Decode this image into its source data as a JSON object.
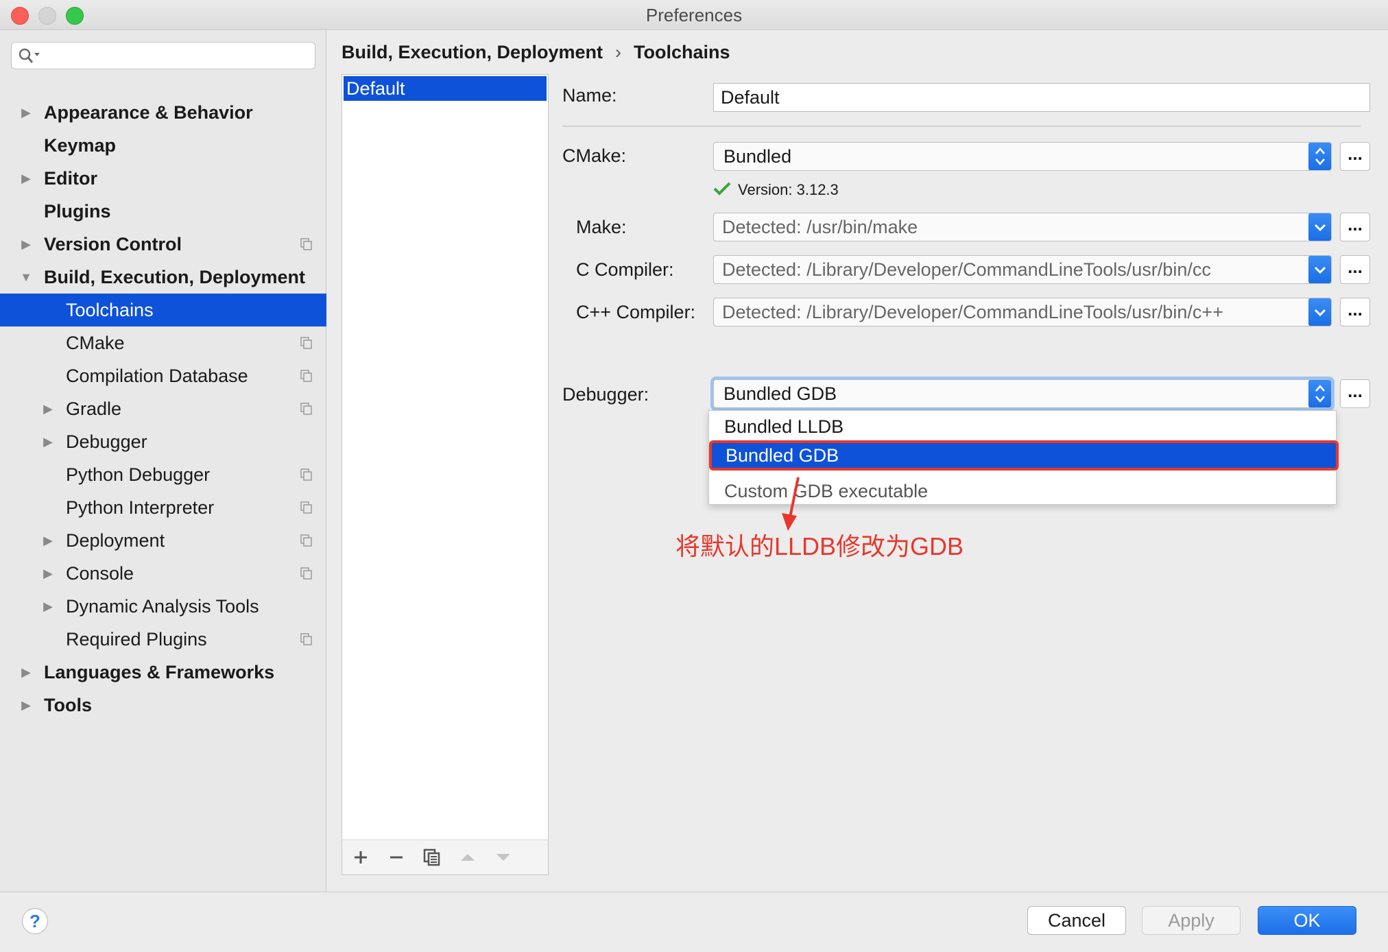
{
  "window": {
    "title": "Preferences"
  },
  "colors": {
    "accent": "#0d52d9",
    "annotation": "#e8372c",
    "check": "#3aa53a"
  },
  "sidebar": {
    "search_placeholder": "",
    "items": [
      {
        "label": "Appearance & Behavior",
        "bold": true,
        "arrow": "right",
        "level": 0,
        "proj": false
      },
      {
        "label": "Keymap",
        "bold": true,
        "arrow": "none",
        "level": 0,
        "proj": false
      },
      {
        "label": "Editor",
        "bold": true,
        "arrow": "right",
        "level": 0,
        "proj": false
      },
      {
        "label": "Plugins",
        "bold": true,
        "arrow": "none",
        "level": 0,
        "proj": false
      },
      {
        "label": "Version Control",
        "bold": true,
        "arrow": "right",
        "level": 0,
        "proj": true
      },
      {
        "label": "Build, Execution, Deployment",
        "bold": true,
        "arrow": "down",
        "level": 0,
        "proj": false
      },
      {
        "label": "Toolchains",
        "bold": false,
        "arrow": "none",
        "level": 1,
        "proj": false,
        "selected": true
      },
      {
        "label": "CMake",
        "bold": false,
        "arrow": "none",
        "level": 1,
        "proj": true
      },
      {
        "label": "Compilation Database",
        "bold": false,
        "arrow": "none",
        "level": 1,
        "proj": true
      },
      {
        "label": "Gradle",
        "bold": false,
        "arrow": "right",
        "level": 1,
        "proj": true
      },
      {
        "label": "Debugger",
        "bold": false,
        "arrow": "right",
        "level": 1,
        "proj": false
      },
      {
        "label": "Python Debugger",
        "bold": false,
        "arrow": "none",
        "level": 1,
        "proj": true
      },
      {
        "label": "Python Interpreter",
        "bold": false,
        "arrow": "none",
        "level": 1,
        "proj": true
      },
      {
        "label": "Deployment",
        "bold": false,
        "arrow": "right",
        "level": 1,
        "proj": true
      },
      {
        "label": "Console",
        "bold": false,
        "arrow": "right",
        "level": 1,
        "proj": true
      },
      {
        "label": "Dynamic Analysis Tools",
        "bold": false,
        "arrow": "right",
        "level": 1,
        "proj": false
      },
      {
        "label": "Required Plugins",
        "bold": false,
        "arrow": "none",
        "level": 1,
        "proj": true
      },
      {
        "label": "Languages & Frameworks",
        "bold": true,
        "arrow": "right",
        "level": 0,
        "proj": false
      },
      {
        "label": "Tools",
        "bold": true,
        "arrow": "right",
        "level": 0,
        "proj": false
      }
    ]
  },
  "breadcrumb": {
    "parent": "Build, Execution, Deployment",
    "separator": "›",
    "current": "Toolchains"
  },
  "toolchains": {
    "items": [
      "Default"
    ]
  },
  "form": {
    "name_label": "Name:",
    "name_value": "Default",
    "cmake_label": "CMake:",
    "cmake_value": "Bundled",
    "version_text": "Version: 3.12.3",
    "make_label": "Make:",
    "make_value": "Detected: /usr/bin/make",
    "c_label": "C Compiler:",
    "c_value": "Detected: /Library/Developer/CommandLineTools/usr/bin/cc",
    "cpp_label": "C++ Compiler:",
    "cpp_value": "Detected: /Library/Developer/CommandLineTools/usr/bin/c++",
    "debugger_label": "Debugger:",
    "debugger_value": "Bundled GDB",
    "browse": "..."
  },
  "dropdown": {
    "options": [
      "Bundled LLDB",
      "Bundled GDB",
      "Custom GDB executable"
    ],
    "selected": "Bundled GDB"
  },
  "annotation": {
    "text": "将默认的LLDB修改为GDB"
  },
  "buttons": {
    "help": "?",
    "cancel": "Cancel",
    "apply": "Apply",
    "ok": "OK"
  }
}
